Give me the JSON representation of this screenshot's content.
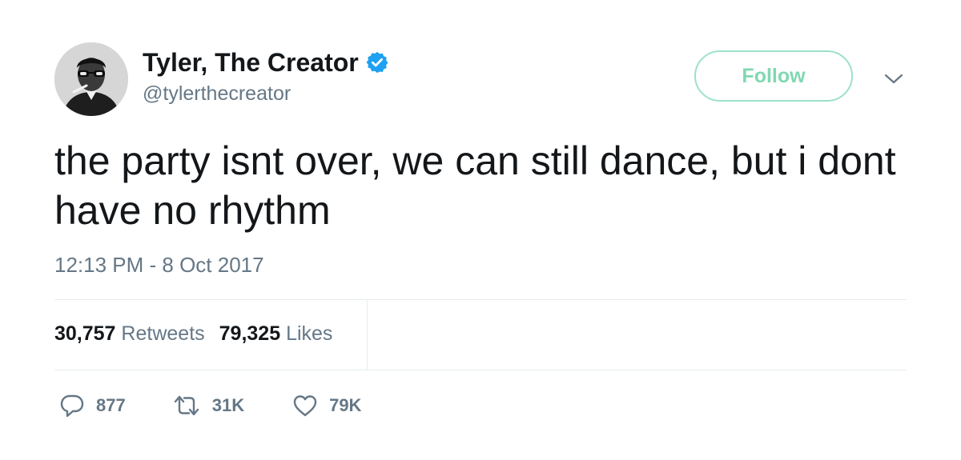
{
  "user": {
    "name": "Tyler, The Creator",
    "handle": "@tylerthecreator",
    "verified": true,
    "avatar_icon": "profile-avatar"
  },
  "follow_button": {
    "label": "Follow"
  },
  "menu": {
    "icon": "chevron-down-icon"
  },
  "tweet": {
    "text": "the party isnt over, we can still dance, but i dont have no rhythm",
    "timestamp": "12:13 PM - 8 Oct 2017"
  },
  "stats": [
    {
      "value": "30,757",
      "label": "Retweets"
    },
    {
      "value": "79,325",
      "label": "Likes"
    }
  ],
  "actions": {
    "reply": {
      "icon": "reply-icon",
      "count": "877"
    },
    "retweet": {
      "icon": "retweet-icon",
      "count": "31K"
    },
    "like": {
      "icon": "heart-icon",
      "count": "79K"
    }
  },
  "colors": {
    "text": "#14171a",
    "muted": "#657786",
    "verified_blue": "#1da1f2",
    "follow_green": "#80d8b3",
    "divider": "#e6ecf0"
  }
}
